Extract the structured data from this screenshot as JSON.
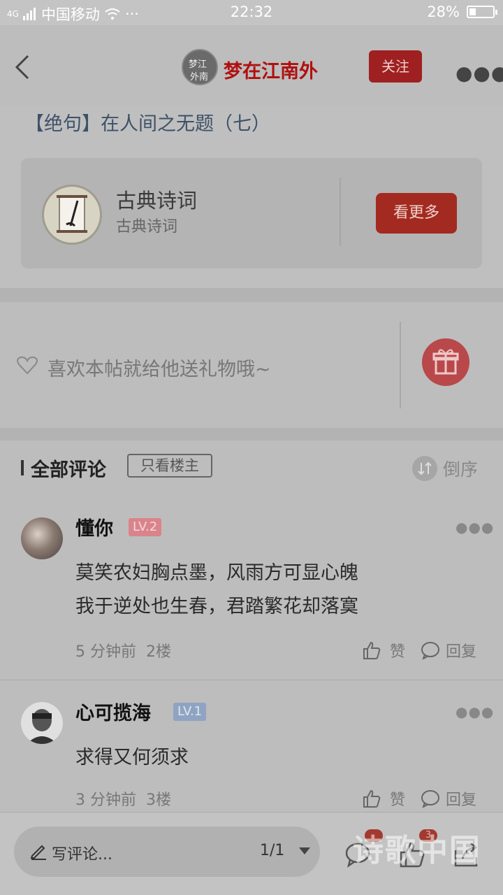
{
  "status": {
    "carrier": "中国移动",
    "signal_type": "4G",
    "time": "22:32",
    "battery": "28%",
    "battery_level": 0.28
  },
  "header": {
    "author": "梦在江南外",
    "follow": "关注"
  },
  "post": {
    "title": "【绝句】在人间之无题（七）"
  },
  "forum_card": {
    "title": "古典诗词",
    "subtitle": "古典诗词",
    "button": "看更多"
  },
  "gift": {
    "text": "喜欢本帖就给他送礼物哦~"
  },
  "comments_header": {
    "title": "全部评论",
    "only_host": "只看楼主",
    "sort": "倒序"
  },
  "comments": [
    {
      "name": "懂你",
      "level": "LV.2",
      "lines": [
        "莫笑农妇胸点墨，风雨方可显心魄",
        "我于逆处也生春，君踏繁花却落寞"
      ],
      "time": "5 分钟前",
      "floor": "2楼",
      "like": "赞",
      "reply": "回复"
    },
    {
      "name": "心可揽海",
      "level": "LV.1",
      "lines": [
        "求得又何须求"
      ],
      "time": "3 分钟前",
      "floor": "3楼",
      "like": "赞",
      "reply": "回复"
    }
  ],
  "bottom": {
    "write": "写评论...",
    "page": "1/1",
    "like_badge": "3"
  },
  "watermark": "诗歌中国",
  "colors": {
    "accent_red": "#a32a20",
    "level2": "#d9848c",
    "level1": "#8fa4c2"
  }
}
